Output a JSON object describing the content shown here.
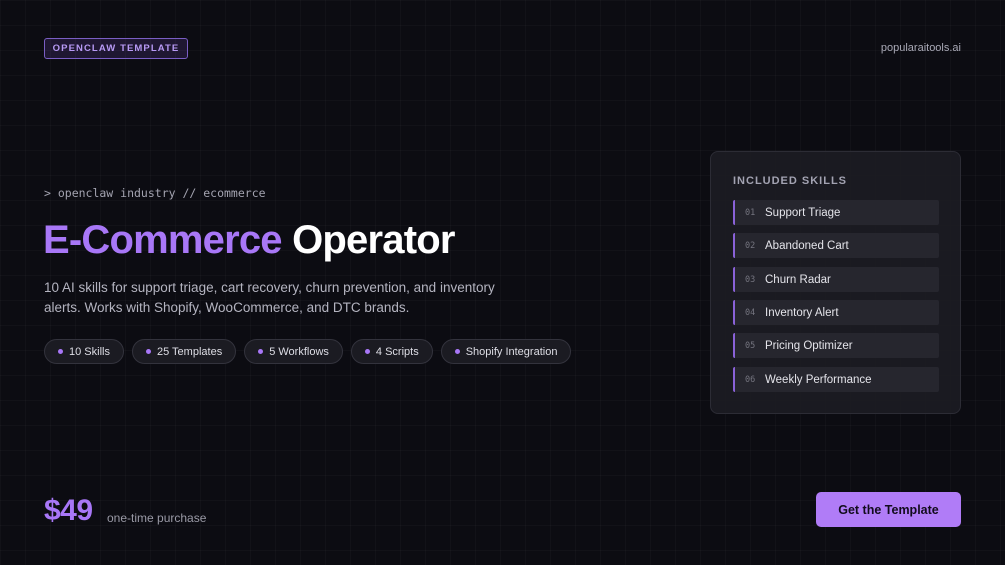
{
  "header": {
    "badge": "OPENCLAW TEMPLATE",
    "site": "popularaitools.ai"
  },
  "hero": {
    "command": "> openclaw industry // ecommerce",
    "title_accent": "E-Commerce",
    "title_main": "Operator",
    "description": "10 AI skills for support triage, cart recovery, churn prevention, and inventory alerts. Works with Shopify, WooCommerce, and DTC brands.",
    "pills": [
      {
        "label": "10 Skills"
      },
      {
        "label": "25 Templates"
      },
      {
        "label": "5 Workflows"
      },
      {
        "label": "4 Scripts"
      },
      {
        "label": "Shopify Integration"
      }
    ]
  },
  "skills_panel": {
    "heading": "INCLUDED SKILLS",
    "items": [
      {
        "num": "01",
        "name": "Support Triage"
      },
      {
        "num": "02",
        "name": "Abandoned Cart"
      },
      {
        "num": "03",
        "name": "Churn Radar"
      },
      {
        "num": "04",
        "name": "Inventory Alert"
      },
      {
        "num": "05",
        "name": "Pricing Optimizer"
      },
      {
        "num": "06",
        "name": "Weekly Performance"
      }
    ]
  },
  "footer": {
    "price": "$49",
    "price_note": "one-time purchase",
    "cta_label": "Get the Template"
  },
  "colors": {
    "background": "#0c0c12",
    "accent": "#a877f7",
    "cta_background": "#b07cf7"
  }
}
